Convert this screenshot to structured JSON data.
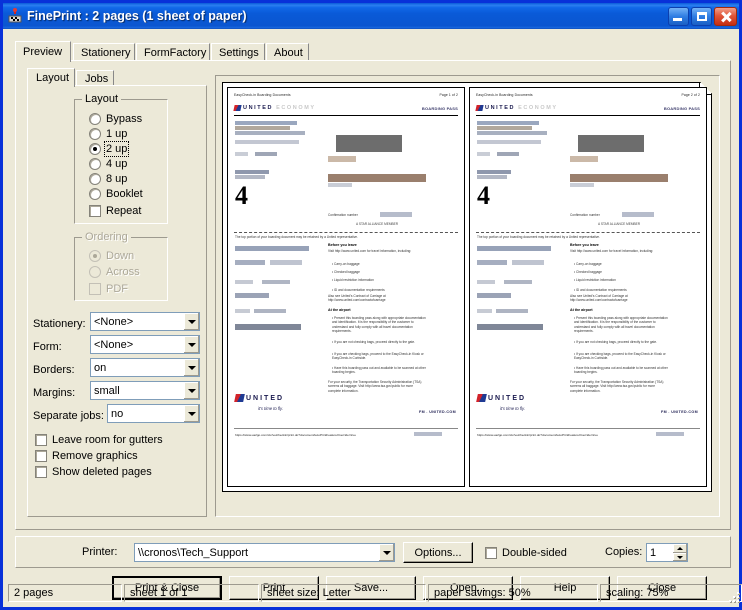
{
  "window": {
    "title": "FinePrint : 2 pages (1 sheet of paper)",
    "icon": "fineprint-icon",
    "minimize": "minimize-button",
    "maximize": "maximize-button",
    "close": "close-button"
  },
  "tabs": {
    "outer": [
      "Preview",
      "Stationery",
      "FormFactory",
      "Settings",
      "About"
    ],
    "outer_active": "Preview",
    "inner": [
      "Layout",
      "Jobs"
    ],
    "inner_active": "Layout"
  },
  "layout_group": {
    "title": "Layout",
    "options": [
      "Bypass",
      "1 up",
      "2 up",
      "4 up",
      "8 up",
      "Booklet"
    ],
    "selected": "2 up",
    "repeat_label": "Repeat",
    "repeat_checked": false
  },
  "ordering_group": {
    "title": "Ordering",
    "enabled": false,
    "options": [
      "Down",
      "Across"
    ],
    "selected": "Down",
    "pdf_label": "PDF",
    "pdf_checked": false
  },
  "fields": [
    {
      "label": "Stationery:",
      "value": "<None>"
    },
    {
      "label": "Form:",
      "value": "<None>"
    },
    {
      "label": "Borders:",
      "value": "on"
    },
    {
      "label": "Margins:",
      "value": "small"
    },
    {
      "label": "Separate jobs:",
      "value": "no"
    }
  ],
  "checkboxes": [
    {
      "label": "Leave room for gutters",
      "checked": false
    },
    {
      "label": "Remove graphics",
      "checked": false
    },
    {
      "label": "Show deleted pages",
      "checked": false
    }
  ],
  "printer_bar": {
    "printer_label": "Printer:",
    "printer_value": "\\\\cronos\\Tech_Support",
    "options_button": "Options...",
    "double_sided_label": "Double-sided",
    "double_sided_checked": false,
    "copies_label": "Copies:",
    "copies_value": "1"
  },
  "buttons": [
    {
      "label": "Print & Close",
      "default": true
    },
    {
      "label": "Print",
      "default": false
    },
    {
      "label": "Save...",
      "default": false
    },
    {
      "label": "Open...",
      "default": false
    },
    {
      "label": "Help",
      "default": false
    },
    {
      "label": "Close",
      "default": false
    }
  ],
  "status": [
    "2 pages",
    "sheet 1 of 1",
    "sheet size: Letter",
    "paper savings: 50%",
    "scaling: 75%"
  ],
  "preview": {
    "pages": [
      {
        "header_left": "EasyCheck-in Boarding Documents",
        "header_right": "Page 1 of 2",
        "brand": "UNITED",
        "brand_sub": "ECONOMY",
        "doc_type": "BOARDING PASS",
        "seat": "4",
        "confirmation_label": "Confirmation number",
        "star_alliance": "A STAR ALLIANCE MEMBER",
        "notice": "The top portion of your boarding document may be retained by a United representative.",
        "section1_title": "Before you leave",
        "section1_intro": "Visit http://www.united.com for travel information, including:",
        "section1_items": [
          "Carry-on baggage",
          "Checked baggage",
          "Liquid restriction information",
          "ID and documentation requirements"
        ],
        "section1_outro": "Also see United's Contract of Carriage at http://www.united.com/contractofcarriage",
        "section2_title": "At the airport",
        "section2_items": [
          "Present this boarding pass along with appropriate documentation and identification. It is the responsibility of the customer to understand and fully comply with all travel documentation requirements.",
          "If you are not checking bags, proceed directly to the gate.",
          "If you are checking bags, proceed to the EasyCheck-in Kiosk or EasyCheck-in Curbside.",
          "Have this boarding pass out and available to be scanned at other boarding begins."
        ],
        "section2_outro": "For your security, the Transportation Security Administration (TSA) screens all baggage. Visit http://www.tsa.gov/public for more complete information.",
        "footer_brand": "UNITED",
        "footer_tagline": "it's time to fly.",
        "footer_url": "FM . UNITED.COM",
        "bottom_url": "https://www.ua2go.com/ctc/velcheckin/print.do?documentAutoPrintFeatureOverride=true"
      },
      {
        "header_left": "EasyCheck-in Boarding Documents",
        "header_right": "Page 2 of 2",
        "brand": "UNITED",
        "brand_sub": "ECONOMY",
        "doc_type": "BOARDING PASS",
        "seat": "4",
        "confirmation_label": "Confirmation number",
        "star_alliance": "A STAR ALLIANCE MEMBER",
        "notice": "The top portion of your boarding document may be retained by a United representative.",
        "section1_title": "Before you leave",
        "section1_intro": "Visit http://www.united.com for travel information, including:",
        "section1_items": [
          "Carry-on baggage",
          "Checked baggage",
          "Liquid restriction information",
          "ID and documentation requirements"
        ],
        "section1_outro": "Also see United's Contract of Carriage at http://www.united.com/contractofcarriage",
        "section2_title": "At the airport",
        "section2_items": [
          "Present this boarding pass along with appropriate documentation and identification. It is the responsibility of the customer to understand and fully comply with all travel documentation requirements.",
          "If you are not checking bags, proceed directly to the gate.",
          "If you are checking bags, proceed to the EasyCheck-in Kiosk or EasyCheck-in Curbside.",
          "Have this boarding pass out and available to be scanned at other boarding begins."
        ],
        "section2_outro": "For your security, the Transportation Security Administration (TSA) screens all baggage. Visit http://www.tsa.gov/public for more complete information.",
        "footer_brand": "UNITED",
        "footer_tagline": "it's time to fly.",
        "footer_url": "FM . UNITED.COM",
        "bottom_url": "https://www.ua2go.com/ctc/velcheckin/print.do?documentAutoPrintFeatureOverride=true"
      }
    ]
  },
  "colors": {
    "title_blue": "#0831d9",
    "face": "#ece9d8",
    "close_red": "#c52d12"
  }
}
